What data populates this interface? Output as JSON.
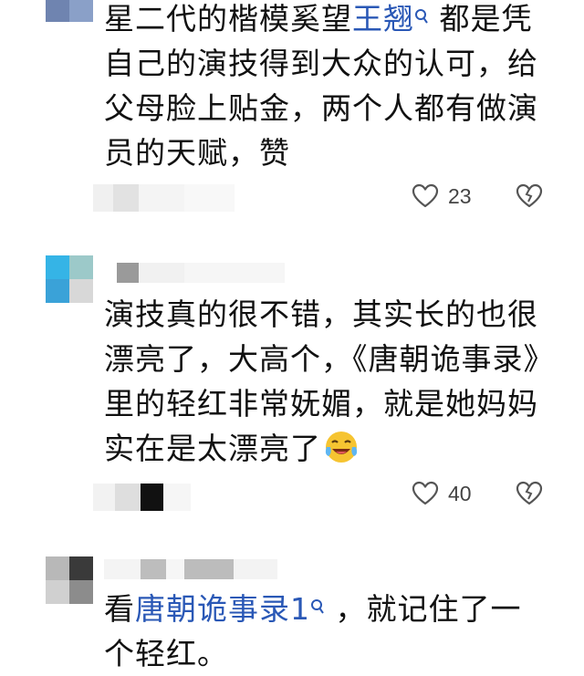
{
  "comments": [
    {
      "text_before_link": "星二代的楷模奚望",
      "link": "王翘",
      "text_after_link": " 都是凭自己的演技得到大众的认可，给父母脸上贴金，两个人都有做演员的天赋，赞",
      "likes": "23"
    },
    {
      "text": "演技真的很不错，其实长的也很漂亮了，大高个，《唐朝诡事录》里的轻红非常妩媚，就是她妈妈实在是太漂亮了",
      "emoji": "laughing-crying-emoji",
      "likes": "40"
    },
    {
      "text_before_link": "看",
      "link": "唐朝诡事录1",
      "text_after_link": " ，就记住了一个轻红。"
    }
  ],
  "icons": {
    "like": "heart-icon",
    "dislike": "broken-heart-icon",
    "search": "search-icon"
  },
  "colors": {
    "link": "#2a58b6",
    "text": "#111111",
    "count": "#444444"
  }
}
